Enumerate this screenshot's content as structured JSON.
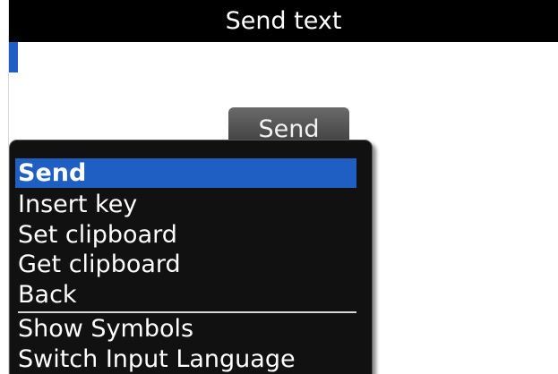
{
  "window": {
    "title": "Send text"
  },
  "editor": {
    "value": ""
  },
  "send_button": {
    "label": "Send"
  },
  "menu": {
    "items": [
      {
        "label": "Send",
        "selected": true
      },
      {
        "label": "Insert key"
      },
      {
        "label": "Set clipboard"
      },
      {
        "label": "Get clipboard"
      },
      {
        "label": "Back"
      },
      {
        "label": "Show Symbols"
      },
      {
        "label": "Switch Input Language"
      }
    ]
  },
  "colors": {
    "accent": "#1f5fc4",
    "title_bar": "#000000",
    "menu_background": "#111111"
  }
}
